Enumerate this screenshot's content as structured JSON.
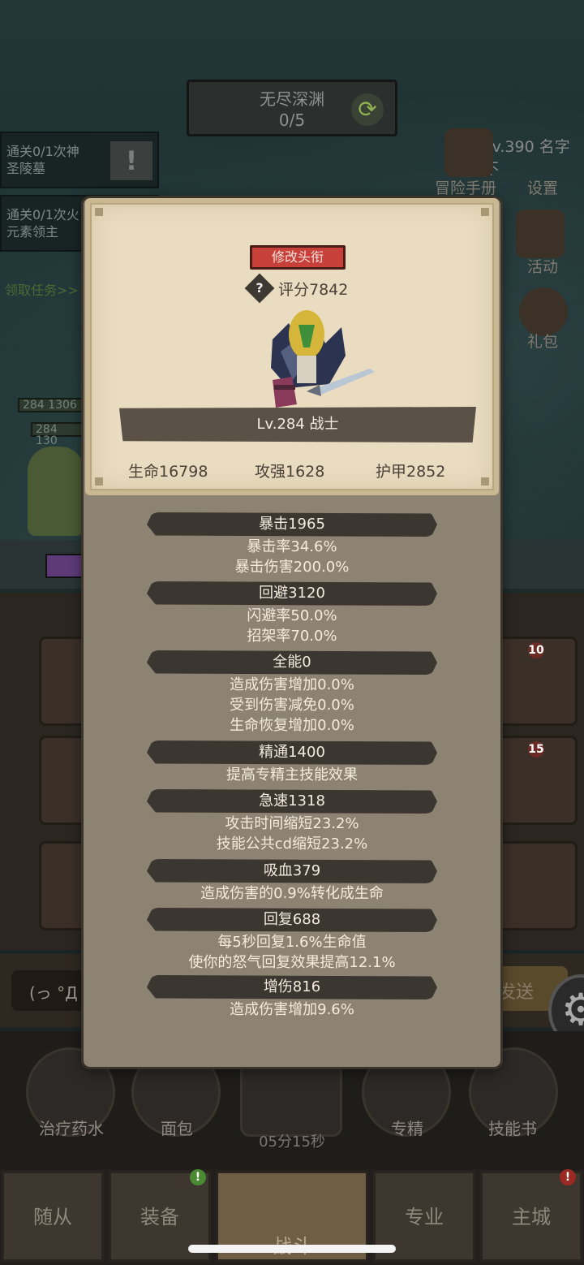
{
  "background": {
    "dungeon": {
      "name": "无尽深渊",
      "progress": "0/5"
    },
    "quests": [
      {
        "line1": "通关0/1次神",
        "line2": "圣陵墓"
      },
      {
        "line1": "通关0/1次火",
        "line2": "元素领主"
      }
    ],
    "claim_task": "领取任务>>",
    "player_level": "Lv.390 名字不",
    "menu": {
      "handbook": "冒险手册",
      "settings": "设置",
      "activity": "活动",
      "gift": "礼包"
    },
    "hp_values": [
      "284",
      "1306",
      "284",
      "130"
    ],
    "chat_placeholder": "(っ °Д °",
    "send": "发送",
    "actions": [
      "治疗药水",
      "面包",
      "专精",
      "技能书"
    ],
    "timer": "05分15秒",
    "tabs": [
      "随从",
      "装备",
      "战斗",
      "专业",
      "主城"
    ],
    "slot_badges": [
      "10",
      "15"
    ],
    "icons": {
      "gear": "gear-icon",
      "refresh": "refresh-icon",
      "alert": "alert-icon"
    }
  },
  "panel": {
    "change_title_button": "修改头衔",
    "help_glyph": "?",
    "rating": "评分7842",
    "character": "Lv.284 战士",
    "core_stats": {
      "hp": "生命16798",
      "attack": "攻强1628",
      "armor": "护甲2852"
    },
    "sections": [
      {
        "title": "暴击1965",
        "lines": [
          "暴击率34.6%",
          "暴击伤害200.0%"
        ]
      },
      {
        "title": "回避3120",
        "lines": [
          "闪避率50.0%",
          "招架率70.0%"
        ]
      },
      {
        "title": "全能0",
        "lines": [
          "造成伤害增加0.0%",
          "受到伤害减免0.0%",
          "生命恢复增加0.0%"
        ]
      },
      {
        "title": "精通1400",
        "lines": [
          "提高专精主技能效果"
        ]
      },
      {
        "title": "急速1318",
        "lines": [
          "攻击时间缩短23.2%",
          "技能公共cd缩短23.2%"
        ]
      },
      {
        "title": "吸血379",
        "lines": [
          "造成伤害的0.9%转化成生命"
        ]
      },
      {
        "title": "回复688",
        "lines": [
          "每5秒回复1.6%生命值",
          "使你的怒气回复效果提高12.1%"
        ]
      },
      {
        "title": "增伤816",
        "lines": [
          "造成伤害增加9.6%"
        ]
      }
    ]
  },
  "colors": {
    "parchment": "#e9dcc0",
    "panel": "#8d8372",
    "title_button": "#c8403a",
    "stat_head": "#3c3630"
  }
}
